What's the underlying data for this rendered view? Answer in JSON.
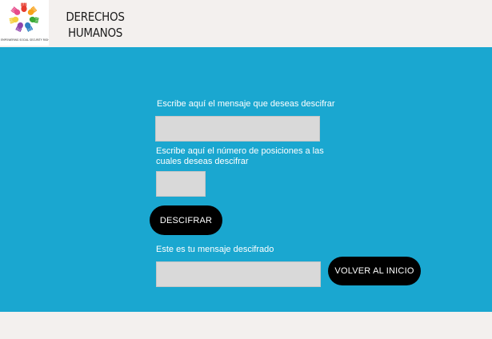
{
  "header": {
    "brand_line1": "DERECHOS",
    "brand_line2": "HUMANOS",
    "logo_caption": "EMPOWERING SOCIAL SECURITY RIGHTS",
    "logo_colors": [
      "#e63b2e",
      "#f7a21b",
      "#3aa935",
      "#2f80c3",
      "#8e44ad",
      "#f4d03f",
      "#e74c8b"
    ]
  },
  "form": {
    "message_label": "Escribe aquí el mensaje que deseas descifrar",
    "message_value": "",
    "positions_label": "Escribe aquí el número de posiciones a las cuales deseas descifrar",
    "positions_value": "",
    "decrypt_button": "DESCIFRAR",
    "result_label": "Este es tu mensaje descifrado",
    "result_value": "",
    "home_button": "VOLVER AL INICIO"
  },
  "colors": {
    "main_background": "#1aa7d0",
    "page_background": "#f3f0ee",
    "field_background": "#d9d9d9",
    "button_background": "#000000"
  }
}
